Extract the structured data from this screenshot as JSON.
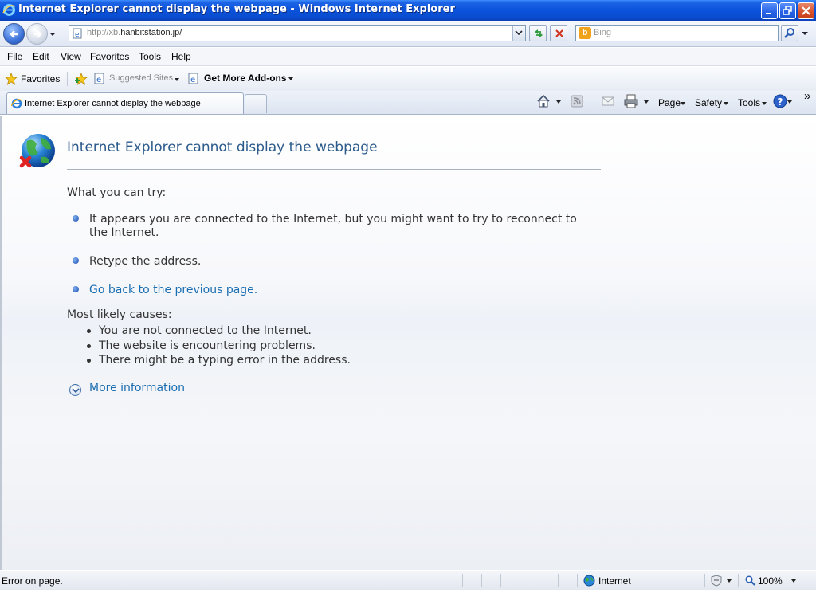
{
  "window": {
    "title": "Internet Explorer cannot display the webpage - Windows Internet Explorer"
  },
  "address": {
    "url_prefix": "http://xb.",
    "url_host": "hanbitstation.jp/",
    "search_placeholder": "Bing"
  },
  "menu": {
    "items": [
      "File",
      "Edit",
      "View",
      "Favorites",
      "Tools",
      "Help"
    ]
  },
  "favorites_bar": {
    "favorites_label": "Favorites",
    "suggested_sites": "Suggested Sites",
    "get_addons": "Get More Add-ons"
  },
  "tab": {
    "active_label": "Internet Explorer cannot display the webpage"
  },
  "command_bar": {
    "page": "Page",
    "safety": "Safety",
    "tools": "Tools",
    "more": "»"
  },
  "content": {
    "title": "Internet Explorer cannot display the webpage",
    "what_you_can_try": "What you can try:",
    "tips": [
      "It appears you are connected to the Internet, but you might want to try to reconnect to",
      "the Internet.",
      "Retype the address.",
      "Go back to the previous page."
    ],
    "causes_heading": "Most likely causes:",
    "causes": [
      "You are not connected to the Internet.",
      "The website is encountering problems.",
      "There might be a typing error in the address."
    ],
    "more_information": "More information"
  },
  "status": {
    "left": "Error on page.",
    "zone": "Internet",
    "zoom": "100%"
  },
  "colors": {
    "title_bar": "#0a52db",
    "link": "#1a6db0",
    "heading": "#2b5a8b"
  }
}
